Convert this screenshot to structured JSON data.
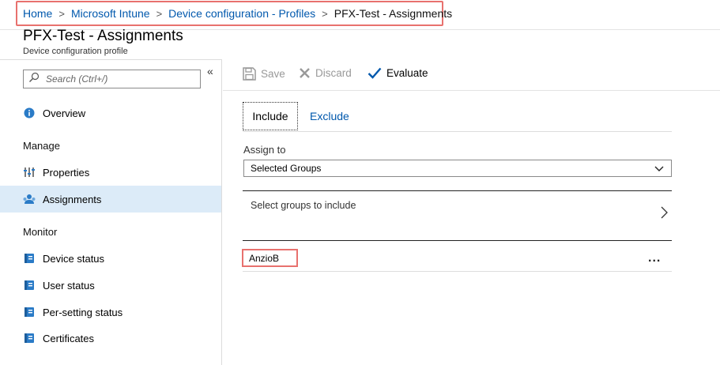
{
  "breadcrumb": {
    "items": [
      "Home",
      "Microsoft Intune",
      "Device configuration - Profiles"
    ],
    "separator": ">",
    "current": "PFX-Test - Assignments"
  },
  "header": {
    "title": "PFX-Test - Assignments",
    "subtitle": "Device configuration profile"
  },
  "sidebar": {
    "search_placeholder": "Search (Ctrl+/)",
    "collapse_glyph": "«",
    "overview": "Overview",
    "manage_header": "Manage",
    "properties": "Properties",
    "assignments": "Assignments",
    "monitor_header": "Monitor",
    "device_status": "Device status",
    "user_status": "User status",
    "per_setting_status": "Per-setting status",
    "certificates": "Certificates"
  },
  "toolbar": {
    "save": "Save",
    "discard": "Discard",
    "evaluate": "Evaluate"
  },
  "tabs": {
    "include": "Include",
    "exclude": "Exclude"
  },
  "assign": {
    "label": "Assign to",
    "selected": "Selected Groups",
    "groups_prompt": "Select groups to include",
    "group_name": "AnzioB",
    "more": "..."
  },
  "colors": {
    "accent": "#0058ad",
    "highlight_border": "#e8716e",
    "active_nav": "#dcebf8"
  }
}
